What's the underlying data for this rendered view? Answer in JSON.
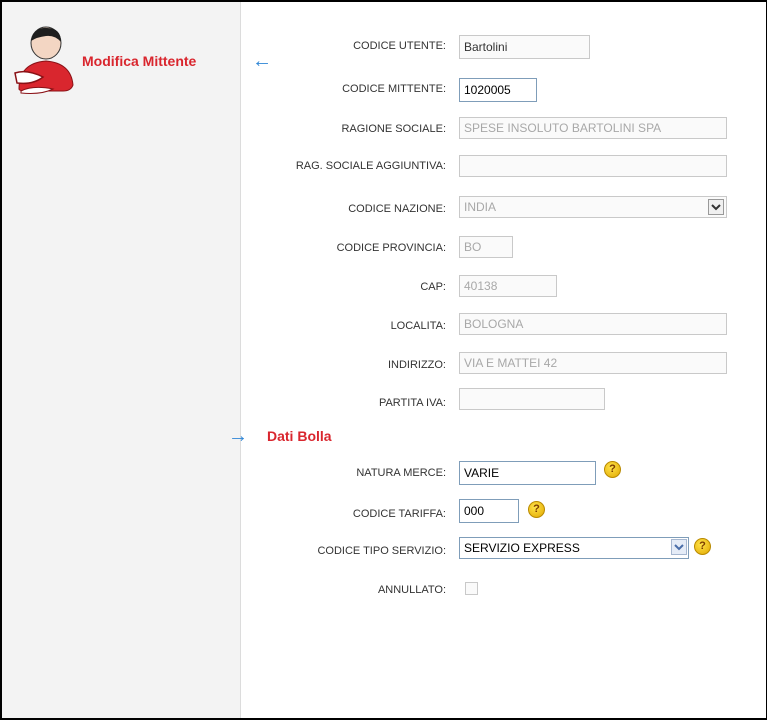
{
  "header": {
    "title": "Modifica Mittente"
  },
  "section2": {
    "title": "Dati Bolla"
  },
  "fields": {
    "codice_utente": {
      "label": "CODICE UTENTE:",
      "value": "Bartolini"
    },
    "codice_mittente": {
      "label": "CODICE MITTENTE:",
      "value": "1020005"
    },
    "ragione_sociale": {
      "label": "RAGIONE SOCIALE:",
      "value": "SPESE INSOLUTO BARTOLINI SPA"
    },
    "rag_sociale_agg": {
      "label": "RAG. SOCIALE AGGIUNTIVA:",
      "value": ""
    },
    "codice_nazione": {
      "label": "CODICE NAZIONE:",
      "value": "INDIA"
    },
    "codice_provincia": {
      "label": "CODICE PROVINCIA:",
      "value": "BO"
    },
    "cap": {
      "label": "CAP:",
      "value": "40138"
    },
    "localita": {
      "label": "LOCALITA:",
      "value": "BOLOGNA"
    },
    "indirizzo": {
      "label": "INDIRIZZO:",
      "value": "VIA E MATTEI 42"
    },
    "partita_iva": {
      "label": "PARTITA IVA:",
      "value": ""
    },
    "natura_merce": {
      "label": "NATURA MERCE:",
      "value": "VARIE"
    },
    "codice_tariffa": {
      "label": "CODICE TARIFFA:",
      "value": "000"
    },
    "codice_tipo_servizio": {
      "label": "CODICE TIPO SERVIZIO:",
      "value": "SERVIZIO EXPRESS"
    },
    "annullato": {
      "label": "ANNULLATO:",
      "checked": false
    }
  },
  "help_glyph": "?",
  "colors": {
    "title_red": "#d9262e",
    "arrow_blue": "#2f86d6"
  }
}
